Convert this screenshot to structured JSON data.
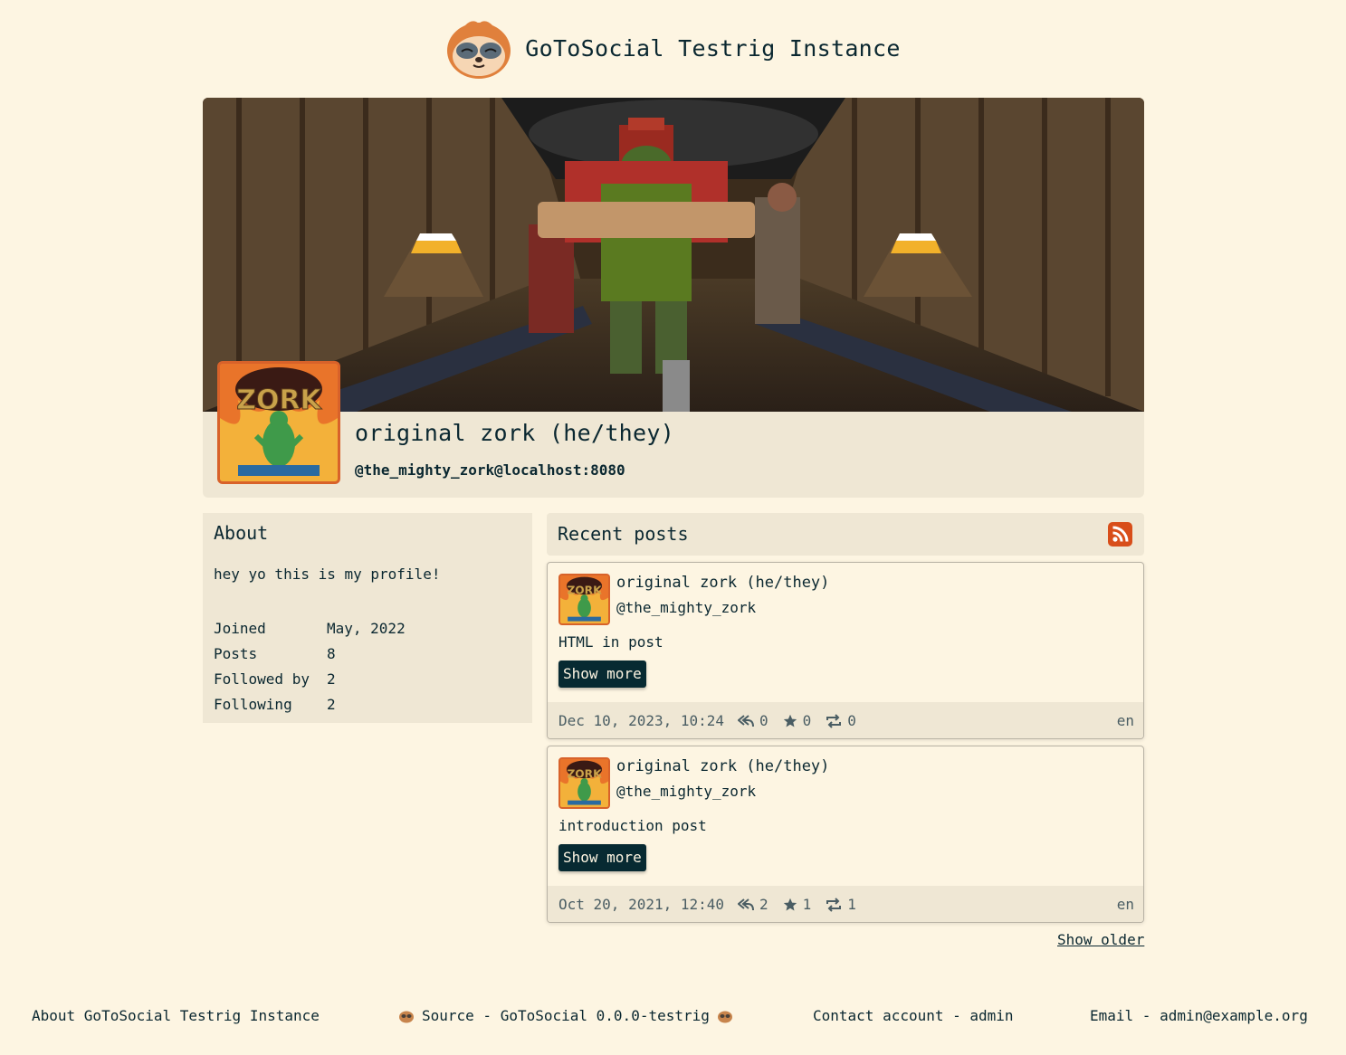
{
  "site": {
    "title": "GoToSocial Testrig Instance"
  },
  "profile": {
    "display_name": "original zork (he/they)",
    "handle": "@the_mighty_zork@localhost:8080"
  },
  "about": {
    "title": "About",
    "bio": "hey yo this is my profile!",
    "stats": [
      {
        "label": "Joined",
        "value": "May, 2022"
      },
      {
        "label": "Posts",
        "value": "8"
      },
      {
        "label": "Followed by",
        "value": "2"
      },
      {
        "label": "Following",
        "value": "2"
      }
    ]
  },
  "recent_posts": {
    "title": "Recent posts",
    "rss_icon": "rss-icon",
    "posts": [
      {
        "author": "original zork (he/they)",
        "handle": "@the_mighty_zork",
        "content": "HTML in post",
        "show_more": "Show more",
        "date": "Dec 10, 2023, 10:24",
        "replies": "0",
        "favourites": "0",
        "boosts": "0",
        "language": "en"
      },
      {
        "author": "original zork (he/they)",
        "handle": "@the_mighty_zork",
        "content": "introduction post",
        "show_more": "Show more",
        "date": "Oct 20, 2021, 12:40",
        "replies": "2",
        "favourites": "1",
        "boosts": "1",
        "language": "en"
      }
    ],
    "show_older": "Show older"
  },
  "footer": {
    "about": "About GoToSocial Testrig Instance",
    "source": "Source - GoToSocial 0.0.0-testrig",
    "contact": "Contact account - admin",
    "email": "Email - admin@example.org"
  },
  "colors": {
    "background": "#fdf5e2",
    "panel": "#efe7d4",
    "text": "#0a2730",
    "button": "#072a32",
    "accent": "#d8622a",
    "rss": "#d84e1a"
  }
}
